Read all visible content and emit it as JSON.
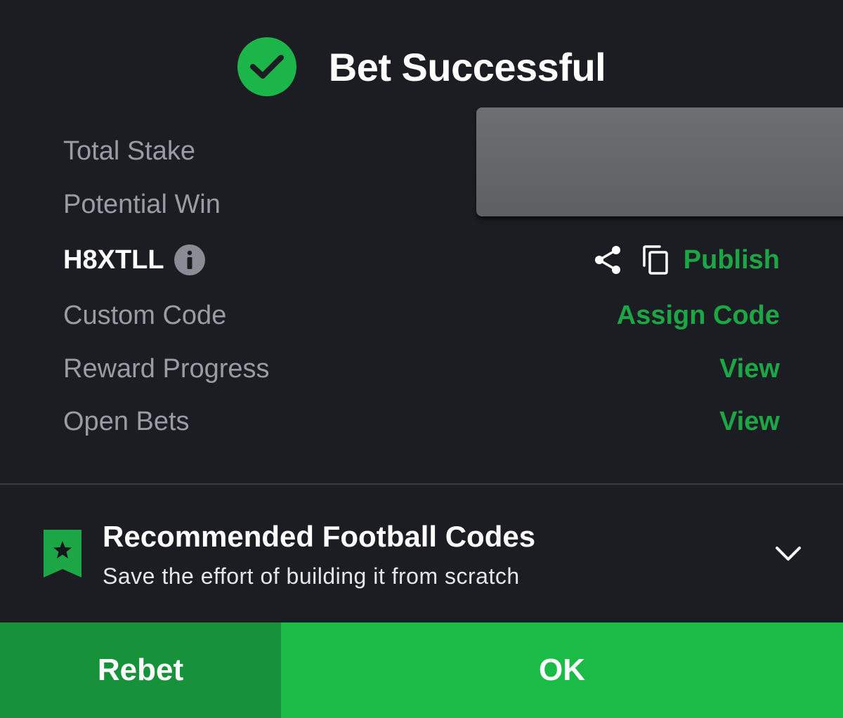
{
  "header": {
    "title": "Bet Successful",
    "icon": "check-circle-icon"
  },
  "details": {
    "total_stake_label": "Total Stake",
    "potential_win_label": "Potential Win",
    "booking_code": "H8XTLL",
    "publish_label": "Publish",
    "custom_code_label": "Custom Code",
    "assign_code_label": "Assign Code",
    "reward_progress_label": "Reward Progress",
    "reward_progress_action": "View",
    "open_bets_label": "Open Bets",
    "open_bets_action": "View"
  },
  "recommended": {
    "title": "Recommended Football Codes",
    "subtitle": "Save the effort of building it from scratch"
  },
  "footer": {
    "rebet_label": "Rebet",
    "ok_label": "OK"
  },
  "colors": {
    "background": "#1c1d22",
    "accent_green": "#1ca646",
    "rebet_button": "#17913a",
    "ok_button": "#1bbb48",
    "label_gray": "#9a9ba5"
  }
}
